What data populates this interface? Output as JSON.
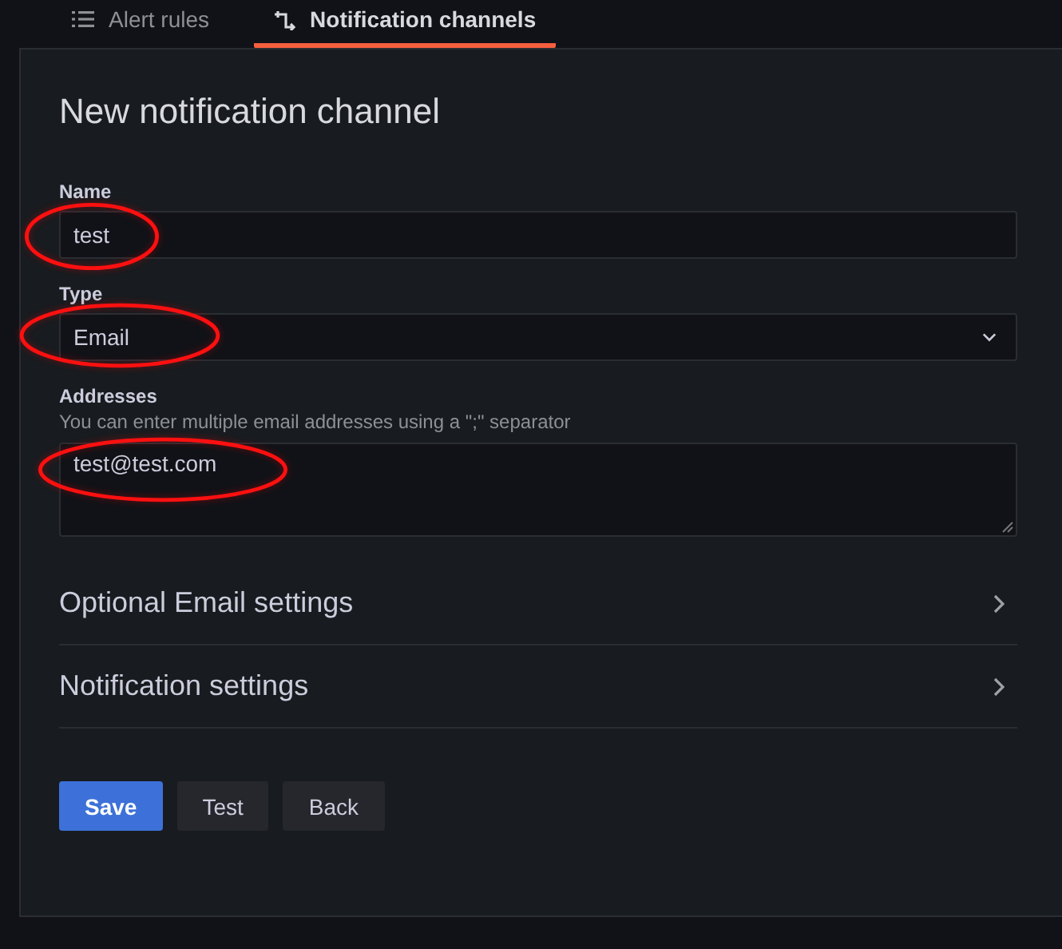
{
  "tabs": [
    {
      "label": "Alert rules",
      "kind": "list",
      "selected": false
    },
    {
      "label": "Notification channels",
      "kind": "channel",
      "selected": true
    }
  ],
  "title": "New notification channel",
  "fields": [
    {
      "kind": "text",
      "label": "Name",
      "value": "test",
      "circled": true
    },
    {
      "kind": "select",
      "label": "Type",
      "value": "Email",
      "circled": true
    },
    {
      "kind": "textarea",
      "label": "Addresses",
      "hint": "You can enter multiple email addresses using a \";\" separator",
      "value": "test@test.com",
      "circled": true
    }
  ],
  "sections": [
    {
      "title": "Optional Email settings",
      "expanded": false
    },
    {
      "title": "Notification settings",
      "expanded": false
    }
  ],
  "buttons": [
    {
      "label": "Save",
      "kind": "primary"
    },
    {
      "label": "Test",
      "kind": "secondary"
    },
    {
      "label": "Back",
      "kind": "secondary"
    }
  ]
}
